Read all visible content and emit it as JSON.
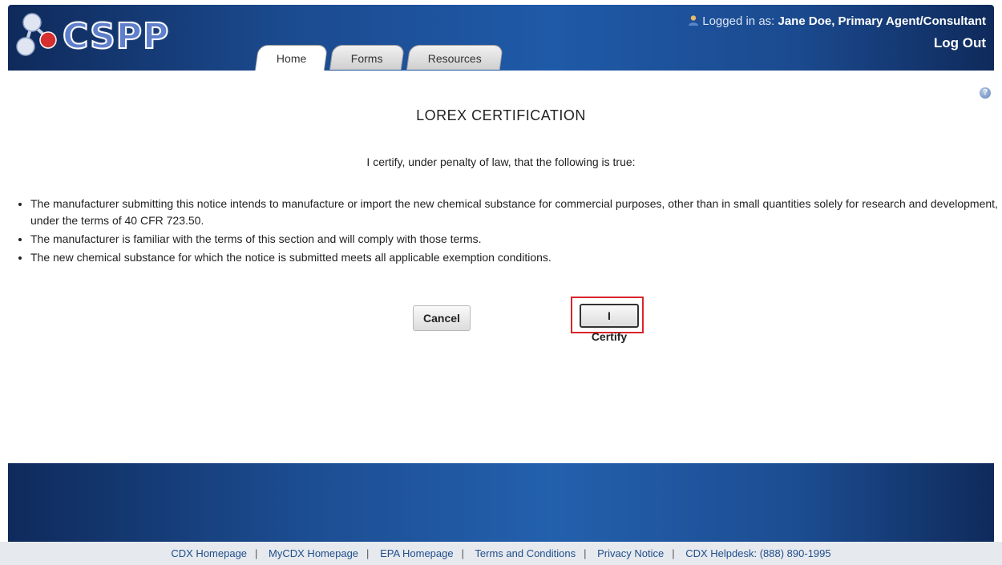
{
  "header": {
    "logo_text": "CSPP",
    "tabs": [
      {
        "label": "Home"
      },
      {
        "label": "Forms"
      },
      {
        "label": "Resources"
      }
    ],
    "login_prefix": "Logged in as:",
    "user_name": "Jane Doe, Primary Agent/Consultant",
    "logout_label": "Log Out"
  },
  "main": {
    "title": "LOREX CERTIFICATION",
    "intro": "I certify, under penalty of law, that the following is true:",
    "bullets": [
      "The manufacturer submitting this notice intends to manufacture or import the new chemical substance for commercial purposes, other than in small quantities solely for research and development, under the terms of 40 CFR 723.50.",
      "The manufacturer is familiar with the terms of this section and will comply with those terms.",
      "The new chemical substance for which the notice is submitted meets all applicable exemption conditions."
    ],
    "cancel_label": "Cancel",
    "certify_label": "I Certify"
  },
  "footer": {
    "links": [
      "CDX Homepage",
      "MyCDX Homepage",
      "EPA Homepage",
      "Terms and Conditions",
      "Privacy Notice",
      "CDX Helpdesk: (888) 890-1995"
    ],
    "separator": "|"
  },
  "colors": {
    "header_blue": "#1f5aa8",
    "highlight_red": "#d9252a"
  },
  "icons": [
    "molecule-logo-icon",
    "user-icon",
    "help-icon"
  ]
}
